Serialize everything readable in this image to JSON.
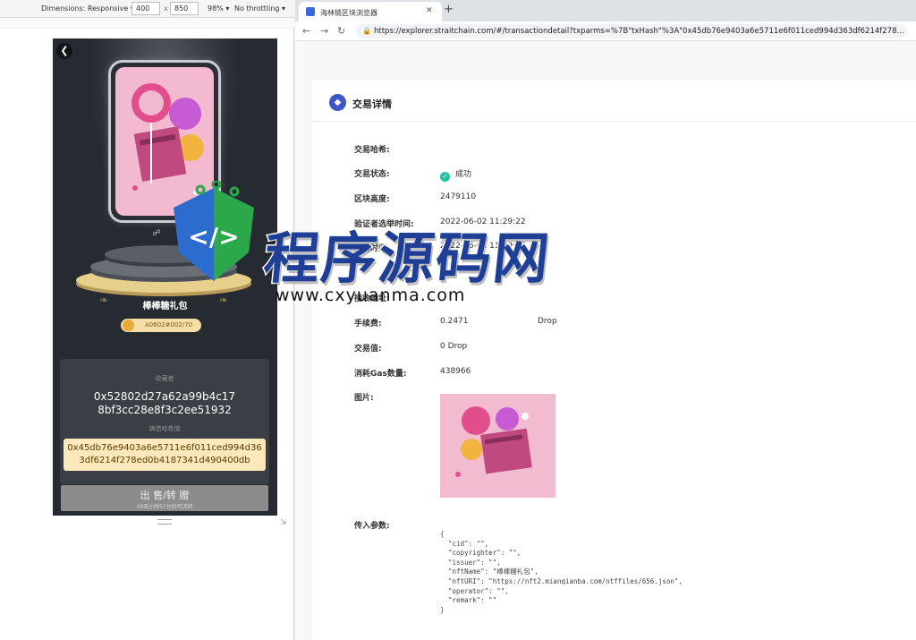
{
  "devtools": {
    "dimensions_label": "Dimensions: Responsive ▾",
    "width": "400",
    "height": "850",
    "times": "x",
    "zoom": "98% ▾",
    "throttling": "No throttling ▾"
  },
  "phone": {
    "nft_name": "棒棒糖礼包",
    "serial": "A0602#002/70",
    "owner_label": "收藏者",
    "owner_address": "0x52802d27a62a99b4c178bf3cc28e8f3c2ee51932",
    "hash_label": "铸造哈希值",
    "hash_value": "0x45db76e9403a6e5711e6f011ced994d363df6214f278ed0b4187341d490400db",
    "sell_button": "出 售/转 赠",
    "sell_note": "19天小时57分后可流转"
  },
  "browser": {
    "tab_title": "海林链区块浏览器",
    "url": "https://explorer.straitchain.com/#/transactiondetail?txparms=%7B\"txHash\"%3A\"0x45db76e9403a6e5711e6f011ced994d363df6214f278...",
    "page_title": "交易详情"
  },
  "details": {
    "hash_label": "交易哈希:",
    "status_label": "交易状态:",
    "status_value": "成功",
    "block_label": "区块高度:",
    "block_value": "2479110",
    "elect_label": "验证者选举时间:",
    "elect_value": "2022-06-02 11:29:22",
    "time_label": "交易时间:",
    "time_value": "2022-06-02 11:29:27",
    "receiver_label": "接收地址:",
    "fee_label": "手续费:",
    "fee_value": "0.2471",
    "fee_unit": "Drop",
    "value_label": "交易值:",
    "value_value": "0 Drop",
    "gas_label": "消耗Gas数量:",
    "gas_value": "438966",
    "image_label": "图片:",
    "params_label": "传入参数:",
    "params_text": "{\n  \"cid\": \"\",\n  \"copyrighter\": \"\",\n  \"issuer\": \"\",\n  \"nftName\": \"棒棒糖礼包\",\n  \"nftURI\": \"https://nft2.mianqianba.com/ntffiles/656.json\",\n  \"operator\": \"\",\n  \"remark\": \"\"\n}"
  },
  "watermark": {
    "title": "程序源码网",
    "url": "www.cxyuanma.com"
  },
  "colors": {
    "success": "#23c4a0",
    "brand": "#3d57c5",
    "hash_box": "#fbe8bb"
  }
}
